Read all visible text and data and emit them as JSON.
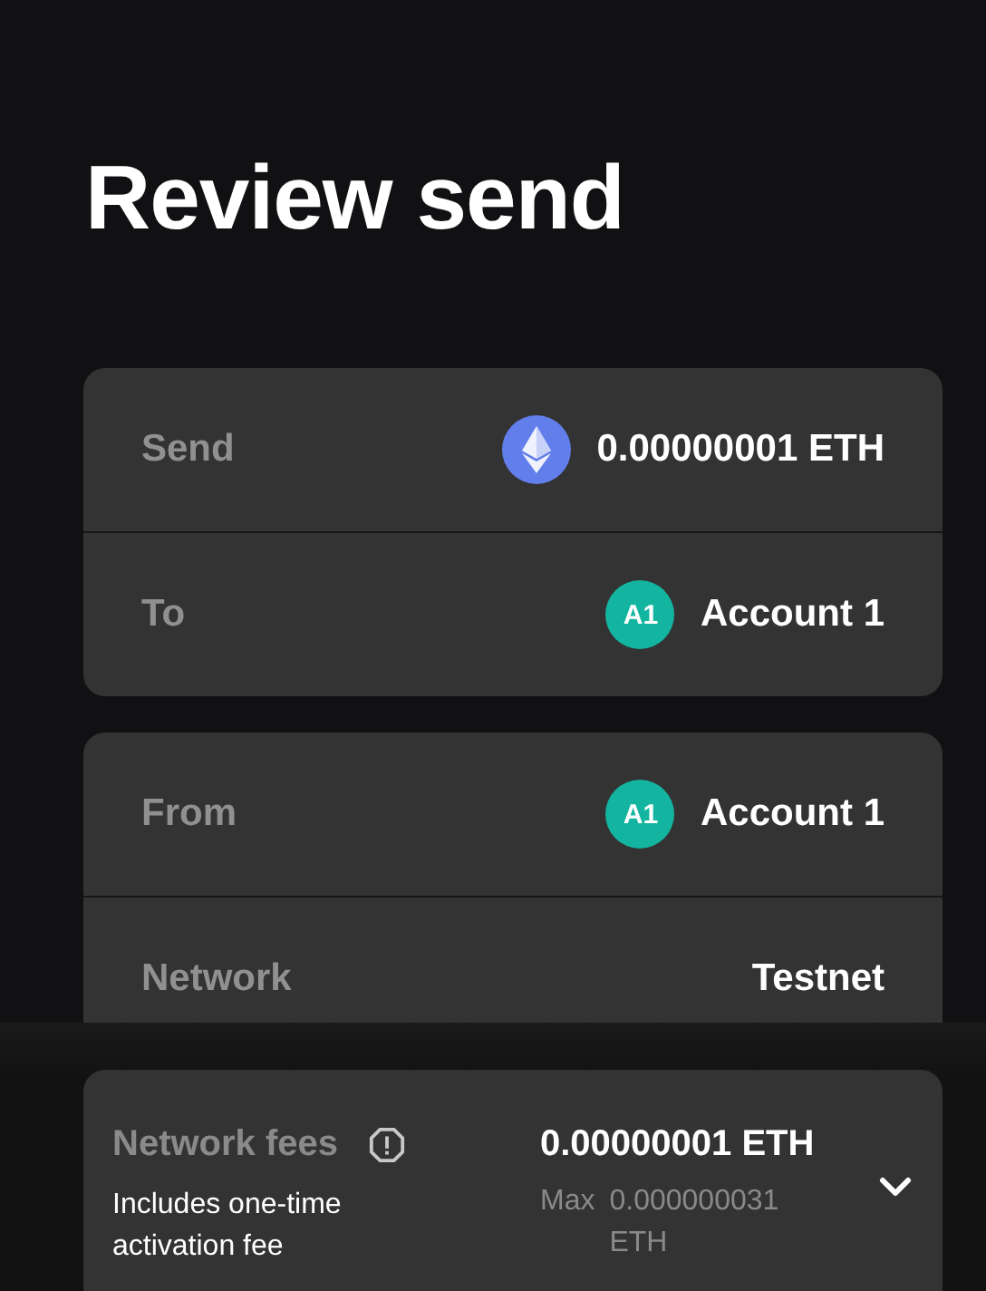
{
  "title": "Review send",
  "cards": [
    {
      "rows": [
        {
          "label": "Send",
          "kind": "token",
          "value": "0.00000001 ETH"
        },
        {
          "label": "To",
          "kind": "account",
          "badge": "A1",
          "color": "#13b5a0",
          "value": "Account 1"
        }
      ]
    },
    {
      "rows": [
        {
          "label": "From",
          "kind": "account",
          "badge": "A1",
          "color": "#13b5a0",
          "value": "Account 1"
        },
        {
          "label": "Network",
          "kind": "plain",
          "value": "Testnet"
        }
      ]
    }
  ],
  "fees": {
    "label": "Network fees",
    "note": "Includes one-time activation fee",
    "amount": "0.00000001 ETH",
    "max_label": "Max",
    "max_value": "0.000000031 ETH",
    "expanded": false
  }
}
